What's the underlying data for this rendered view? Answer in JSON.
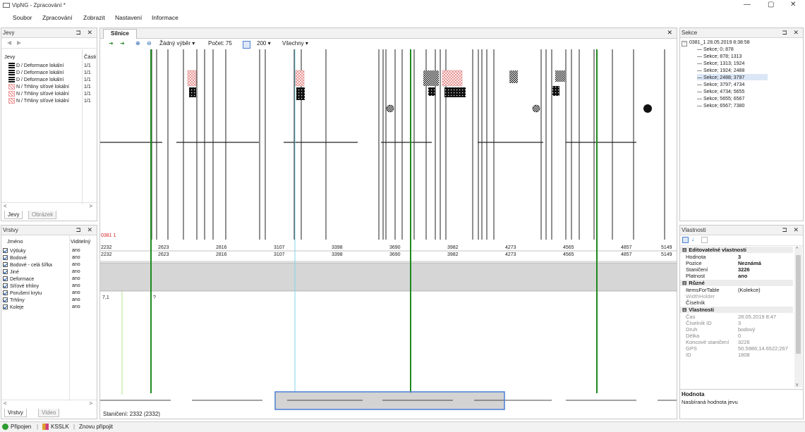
{
  "window": {
    "title": "VipNG - Zpracování *",
    "controls": [
      "—",
      "▢",
      "✕"
    ]
  },
  "menu": [
    "Soubor",
    "Zpracování",
    "Zobrazit",
    "Nastavení",
    "Informace"
  ],
  "jevy": {
    "title": "Jevy",
    "columns": [
      "Jevy",
      "Části"
    ],
    "rows": [
      {
        "name": "D / Deformace lokální",
        "part": "1/1",
        "icon": "dark-grid-icon"
      },
      {
        "name": "D / Deformace lokální",
        "part": "1/1",
        "icon": "dark-grid-icon"
      },
      {
        "name": "D / Deformace lokální",
        "part": "1/1",
        "icon": "dark-grid-icon"
      },
      {
        "name": "N / Trhliny síťové lokální",
        "part": "1/1",
        "icon": "red-mesh-icon"
      },
      {
        "name": "N / Trhliny síťové lokální",
        "part": "1/1",
        "icon": "red-mesh-icon"
      },
      {
        "name": "N / Trhliny síťové lokální",
        "part": "1/1",
        "icon": "red-mesh-icon"
      }
    ],
    "tabs": [
      "Jevy",
      "Obrázek"
    ]
  },
  "vrstvy": {
    "title": "Vrstvy",
    "columns": [
      "Jméno",
      "Viditelný"
    ],
    "rows": [
      {
        "name": "Výtluky",
        "visible": "ano"
      },
      {
        "name": "Bodové",
        "visible": "ano"
      },
      {
        "name": "Bodové - celá šířka",
        "visible": "ano"
      },
      {
        "name": "Jiné",
        "visible": "ano"
      },
      {
        "name": "Deformace",
        "visible": "ano"
      },
      {
        "name": "Síťové trhliny",
        "visible": "ano"
      },
      {
        "name": "Porušení krytu",
        "visible": "ano"
      },
      {
        "name": "Trhliny",
        "visible": "ano"
      },
      {
        "name": "Koleje",
        "visible": "ano"
      }
    ],
    "tabs": [
      "Vrstvy",
      "Video"
    ]
  },
  "main": {
    "tab": "Silnice",
    "toolbar": {
      "selection": "Žádný výběr",
      "count_label": "Počet: 75",
      "zoom_value": "200",
      "filter": "Všechny"
    },
    "ruler_label": "0381 1",
    "ruler_top": [
      "2232",
      "2623",
      "2816",
      "3107",
      "3398",
      "3690",
      "3982",
      "4273",
      "4565",
      "4857",
      "5149"
    ],
    "ruler_bottom": [
      "2232",
      "2623",
      "2816",
      "3107",
      "3398",
      "3690",
      "3982",
      "4273",
      "4565",
      "4857",
      "5149"
    ],
    "lower_labels": [
      "7,1",
      "?"
    ],
    "status": "Staničení: 2332 (2332)"
  },
  "sekce": {
    "title": "Sekce",
    "root": "0381_1  28.05.2019 8:38:58",
    "items": [
      "Sekce; 0; 878",
      "Sekce; 878; 1313",
      "Sekce; 1313; 1924",
      "Sekce; 1924; 2488",
      "Sekce; 2488; 3797",
      "Sekce; 3797; 4734",
      "Sekce; 4734; 5655",
      "Sekce; 5655; 6567",
      "Sekce; 6567; 7380"
    ]
  },
  "vlastnosti": {
    "title": "Vlastnosti",
    "cat1": "Editovatelné vlastnosti",
    "editable": [
      {
        "k": "Hodnota",
        "v": "3"
      },
      {
        "k": "Pozice",
        "v": "Neznámá"
      },
      {
        "k": "Staničení",
        "v": "3226"
      },
      {
        "k": "Platnost",
        "v": "ano"
      }
    ],
    "cat2": "Různé",
    "misc": [
      {
        "k": "ItemsForTable",
        "v": "(Kolekce)"
      },
      {
        "k": "WidthHolder",
        "v": ""
      },
      {
        "k": "Číselník",
        "v": ""
      }
    ],
    "cat3": "Vlastnosti",
    "props": [
      {
        "k": "Čas",
        "v": "28.05.2019 8:47"
      },
      {
        "k": "Číselník ID",
        "v": "3"
      },
      {
        "k": "Druh",
        "v": "bodový"
      },
      {
        "k": "Délka",
        "v": "0"
      },
      {
        "k": "Koncové staničení",
        "v": "3226"
      },
      {
        "k": "GPS",
        "v": "50.5986;14.6522;267"
      },
      {
        "k": "ID",
        "v": "1808"
      }
    ],
    "desc_title": "Hodnota",
    "desc_text": "Nasbíraná hodnota jevu"
  },
  "statusbar": {
    "connected": "Připojen",
    "device": "KSSLK",
    "reconnect": "Znovu připojit"
  },
  "colors": {
    "green": "#1e8a1e",
    "cyan": "#7fd7e8",
    "selection": "#4a7fd4"
  }
}
